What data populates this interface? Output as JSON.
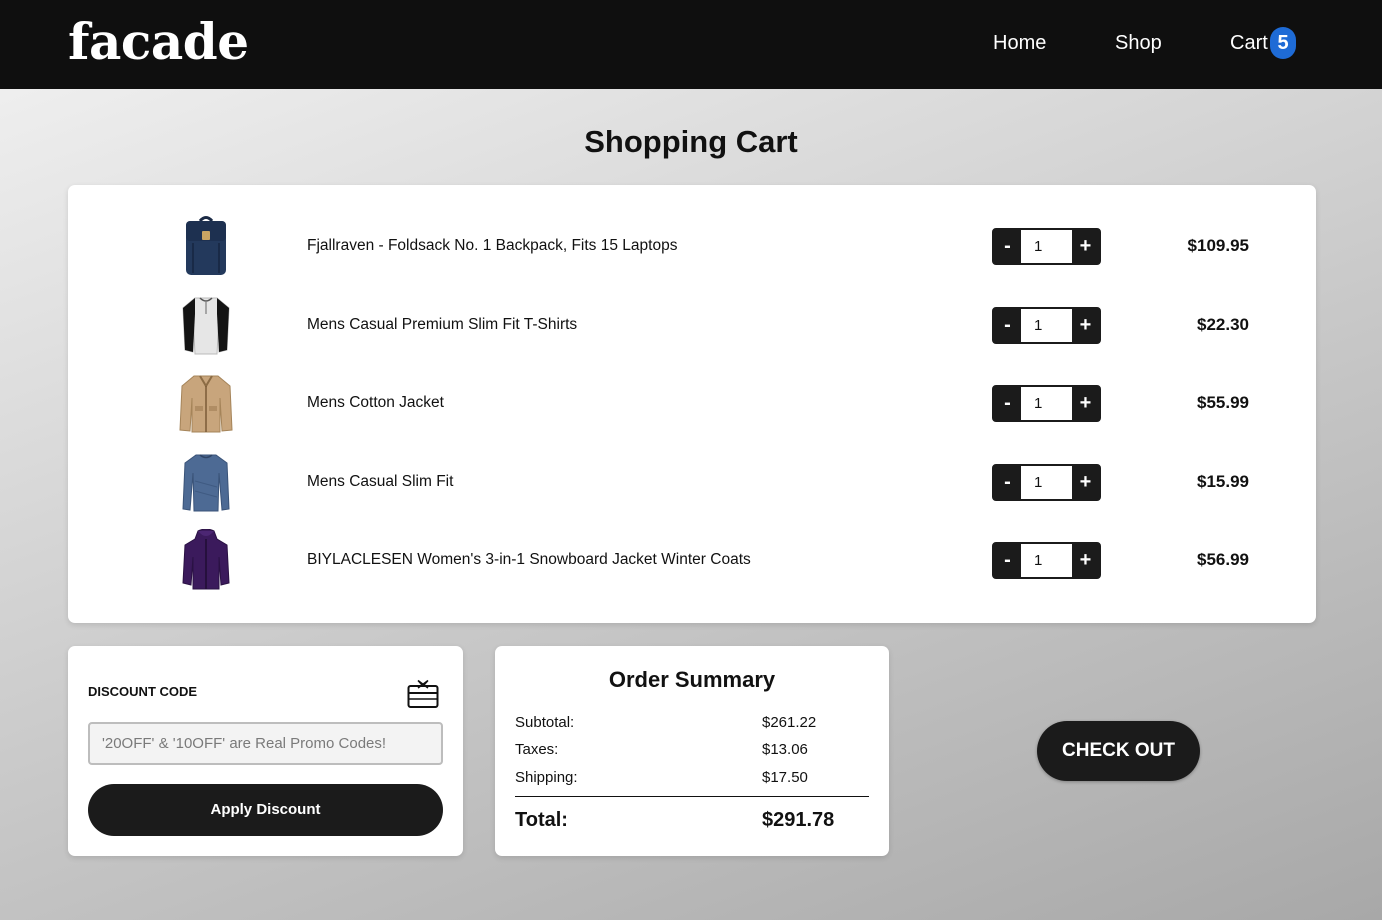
{
  "header": {
    "logo": "facade",
    "nav": {
      "home": "Home",
      "shop": "Shop",
      "cart": "Cart"
    },
    "cart_count": "5"
  },
  "page_title": "Shopping Cart",
  "cart": {
    "items": [
      {
        "name": "Fjallraven - Foldsack No. 1 Backpack, Fits 15 Laptops",
        "qty": "1",
        "price": "$109.95",
        "icon": "backpack-icon"
      },
      {
        "name": "Mens Casual Premium Slim Fit T-Shirts",
        "qty": "1",
        "price": "$22.30",
        "icon": "tshirt-icon"
      },
      {
        "name": "Mens Cotton Jacket",
        "qty": "1",
        "price": "$55.99",
        "icon": "jacket-icon"
      },
      {
        "name": "Mens Casual Slim Fit",
        "qty": "1",
        "price": "$15.99",
        "icon": "longsleeve-icon"
      },
      {
        "name": "BIYLACLESEN Women's 3-in-1 Snowboard Jacket Winter Coats",
        "qty": "1",
        "price": "$56.99",
        "icon": "coat-icon"
      }
    ],
    "minus_label": "-",
    "plus_label": "+"
  },
  "discount": {
    "title": "DISCOUNT CODE",
    "placeholder": "'20OFF' & '10OFF' are Real Promo Codes!",
    "apply_label": "Apply Discount"
  },
  "summary": {
    "title": "Order Summary",
    "subtotal_label": "Subtotal:",
    "subtotal_value": "$261.22",
    "taxes_label": "Taxes:",
    "taxes_value": "$13.06",
    "shipping_label": "Shipping:",
    "shipping_value": "$17.50",
    "total_label": "Total:",
    "total_value": "$291.78"
  },
  "checkout_label": "CHECK OUT",
  "colors": {
    "header_bg": "#0f0f0f",
    "badge": "#1e6bd6",
    "button_dark": "#1b1b1b"
  }
}
